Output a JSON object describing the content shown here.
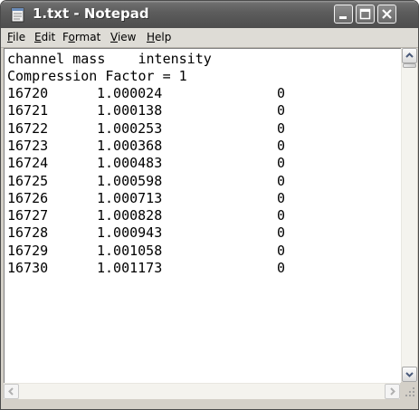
{
  "window": {
    "title": "1.txt - Notepad",
    "icon": "notepad-icon",
    "controls": [
      "minimize-icon",
      "maximize-icon",
      "close-icon"
    ]
  },
  "menu": {
    "file": {
      "mnemonic": "F",
      "rest": "ile"
    },
    "edit": {
      "mnemonic": "E",
      "rest": "dit"
    },
    "format": {
      "pre": "F",
      "mnemonic": "o",
      "rest": "rmat"
    },
    "view": {
      "mnemonic": "V",
      "rest": "iew"
    },
    "help": {
      "mnemonic": "H",
      "rest": "elp"
    }
  },
  "document": {
    "header": "channel mass    intensity",
    "compression_line": "Compression Factor = 1",
    "rows": [
      {
        "channel": "16720",
        "mass": "1.000024",
        "intensity": "0"
      },
      {
        "channel": "16721",
        "mass": "1.000138",
        "intensity": "0"
      },
      {
        "channel": "16722",
        "mass": "1.000253",
        "intensity": "0"
      },
      {
        "channel": "16723",
        "mass": "1.000368",
        "intensity": "0"
      },
      {
        "channel": "16724",
        "mass": "1.000483",
        "intensity": "0"
      },
      {
        "channel": "16725",
        "mass": "1.000598",
        "intensity": "0"
      },
      {
        "channel": "16726",
        "mass": "1.000713",
        "intensity": "0"
      },
      {
        "channel": "16727",
        "mass": "1.000828",
        "intensity": "0"
      },
      {
        "channel": "16728",
        "mass": "1.000943",
        "intensity": "0"
      },
      {
        "channel": "16729",
        "mass": "1.001058",
        "intensity": "0"
      },
      {
        "channel": "16730",
        "mass": "1.001173",
        "intensity": "0"
      }
    ]
  },
  "scrollbars": {
    "up": "scroll-up-arrow-icon",
    "down": "scroll-down-arrow-icon",
    "left": "scroll-left-arrow-icon",
    "right": "scroll-right-arrow-icon",
    "grip": "resize-grip-icon"
  }
}
